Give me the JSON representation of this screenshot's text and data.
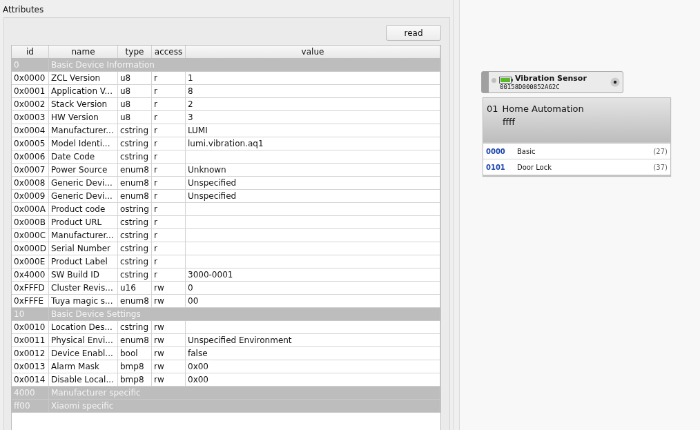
{
  "panel": {
    "title": "Attributes",
    "read_button": "read"
  },
  "table": {
    "columns": [
      "id",
      "name",
      "type",
      "access",
      "value"
    ],
    "rows": [
      {
        "kind": "group",
        "id": "0",
        "name": "Basic Device Information"
      },
      {
        "kind": "attribute",
        "id": "0x0000",
        "name": "ZCL Version",
        "type": "u8",
        "access": "r",
        "value": "1"
      },
      {
        "kind": "attribute",
        "id": "0x0001",
        "name": "Application V...",
        "type": "u8",
        "access": "r",
        "value": "8"
      },
      {
        "kind": "attribute",
        "id": "0x0002",
        "name": "Stack Version",
        "type": "u8",
        "access": "r",
        "value": "2"
      },
      {
        "kind": "attribute",
        "id": "0x0003",
        "name": "HW Version",
        "type": "u8",
        "access": "r",
        "value": "3"
      },
      {
        "kind": "attribute",
        "id": "0x0004",
        "name": "Manufacturer...",
        "type": "cstring",
        "access": "r",
        "value": "LUMI"
      },
      {
        "kind": "attribute",
        "id": "0x0005",
        "name": "Model Identi...",
        "type": "cstring",
        "access": "r",
        "value": "lumi.vibration.aq1"
      },
      {
        "kind": "attribute",
        "id": "0x0006",
        "name": "Date Code",
        "type": "cstring",
        "access": "r",
        "value": ""
      },
      {
        "kind": "attribute",
        "id": "0x0007",
        "name": "Power Source",
        "type": "enum8",
        "access": "r",
        "value": "Unknown"
      },
      {
        "kind": "attribute",
        "id": "0x0008",
        "name": "Generic Devi...",
        "type": "enum8",
        "access": "r",
        "value": "Unspecified"
      },
      {
        "kind": "attribute",
        "id": "0x0009",
        "name": "Generic Devi...",
        "type": "enum8",
        "access": "r",
        "value": "Unspecified"
      },
      {
        "kind": "attribute",
        "id": "0x000A",
        "name": "Product code",
        "type": "ostring",
        "access": "r",
        "value": ""
      },
      {
        "kind": "attribute",
        "id": "0x000B",
        "name": "Product URL",
        "type": "cstring",
        "access": "r",
        "value": ""
      },
      {
        "kind": "attribute",
        "id": "0x000C",
        "name": "Manufacturer...",
        "type": "cstring",
        "access": "r",
        "value": ""
      },
      {
        "kind": "attribute",
        "id": "0x000D",
        "name": "Serial Number",
        "type": "cstring",
        "access": "r",
        "value": ""
      },
      {
        "kind": "attribute",
        "id": "0x000E",
        "name": "Product Label",
        "type": "cstring",
        "access": "r",
        "value": ""
      },
      {
        "kind": "attribute",
        "id": "0x4000",
        "name": "SW Build ID",
        "type": "cstring",
        "access": "r",
        "value": "3000-0001"
      },
      {
        "kind": "attribute",
        "id": "0xFFFD",
        "name": "Cluster Revis...",
        "type": "u16",
        "access": "rw",
        "value": "0"
      },
      {
        "kind": "attribute",
        "id": "0xFFFE",
        "name": "Tuya magic s...",
        "type": "enum8",
        "access": "rw",
        "value": "00"
      },
      {
        "kind": "group",
        "id": "10",
        "name": "Basic Device Settings"
      },
      {
        "kind": "attribute",
        "id": "0x0010",
        "name": "Location Des...",
        "type": "cstring",
        "access": "rw",
        "value": ""
      },
      {
        "kind": "attribute",
        "id": "0x0011",
        "name": "Physical Envi...",
        "type": "enum8",
        "access": "rw",
        "value": "Unspecified Environment"
      },
      {
        "kind": "attribute",
        "id": "0x0012",
        "name": "Device Enabl...",
        "type": "bool",
        "access": "rw",
        "value": "false"
      },
      {
        "kind": "attribute",
        "id": "0x0013",
        "name": "Alarm Mask",
        "type": "bmp8",
        "access": "rw",
        "value": "0x00"
      },
      {
        "kind": "attribute",
        "id": "0x0014",
        "name": "Disable Local...",
        "type": "bmp8",
        "access": "rw",
        "value": "0x00"
      },
      {
        "kind": "group",
        "id": "4000",
        "name": "Manufacturer specific"
      },
      {
        "kind": "group",
        "id": "ff00",
        "name": "Xiaomi specific"
      }
    ]
  },
  "device": {
    "name": "Vibration Sensor",
    "address": "00158D000852A62C"
  },
  "endpoint": {
    "number": "01",
    "profile": "Home Automation",
    "device_id": "ffff",
    "clusters": [
      {
        "id": "0000",
        "name": "Basic",
        "count": "(27)"
      },
      {
        "id": "0101",
        "name": "Door Lock",
        "count": "(37)"
      }
    ]
  }
}
